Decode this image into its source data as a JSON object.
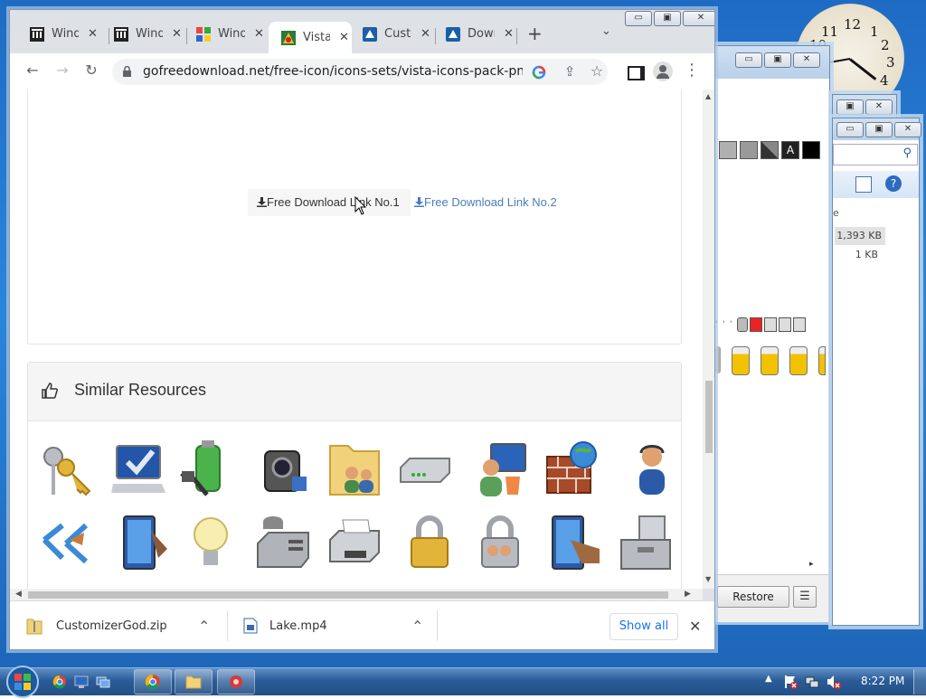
{
  "browser": {
    "tabs": [
      {
        "label": "Windows",
        "active": false
      },
      {
        "label": "Windows",
        "active": false
      },
      {
        "label": "Windows",
        "active": false
      },
      {
        "label": "Vista",
        "active": true
      },
      {
        "label": "Customizer",
        "active": false
      },
      {
        "label": "Download",
        "active": false
      }
    ],
    "new_tab": "+",
    "url": "gofreedownload.net/free-icon/icons-sets/vista-icons-pack-png-ico...",
    "window_buttons": {
      "minimize": "▭",
      "restore": "▣",
      "close": "✕"
    }
  },
  "page": {
    "download_link_1": "Free Download Link No.1",
    "download_link_2": "Free Download Link No.2",
    "similar_title": "Similar Resources",
    "icons_row1": [
      "keys",
      "monitor-check",
      "battery-plug",
      "camcorder",
      "users-folder",
      "router",
      "network-user",
      "firewall",
      "user-support"
    ],
    "icons_row2": [
      "network-arrows",
      "tablet-pen",
      "light-bulb",
      "fax-phone",
      "printer",
      "padlock",
      "user-lock",
      "tablet-touch",
      "toolbox"
    ]
  },
  "downloads": {
    "items": [
      {
        "name": "CustomizerGod.zip"
      },
      {
        "name": "Lake.mp4"
      }
    ],
    "show_all": "Show all"
  },
  "background_window": {
    "file_sizes": [
      "1,393 KB",
      "1 KB"
    ],
    "letter_e": "e",
    "restore_button": "Restore"
  },
  "clock": {
    "numbers": [
      "12",
      "1",
      "2",
      "3",
      "4",
      "11",
      "10"
    ]
  },
  "taskbar": {
    "time": "8:22 PM"
  }
}
